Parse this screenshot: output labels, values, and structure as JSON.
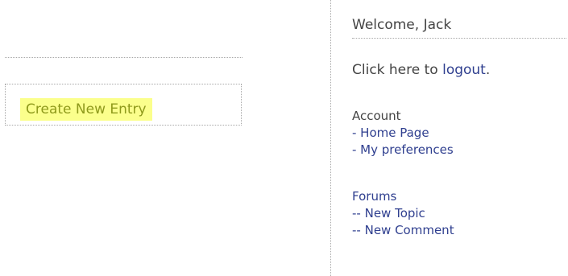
{
  "main": {
    "create_entry_label": "Create New Entry"
  },
  "sidebar": {
    "welcome_text": "Welcome, Jack",
    "logout_prefix": "Click here to ",
    "logout_link": "logout",
    "logout_suffix": ".",
    "account": {
      "title": "Account",
      "links": [
        "- Home Page",
        "- My preferences"
      ]
    },
    "forums": {
      "title": "Forums",
      "links": [
        "-- New Topic",
        "-- New Comment"
      ]
    }
  }
}
